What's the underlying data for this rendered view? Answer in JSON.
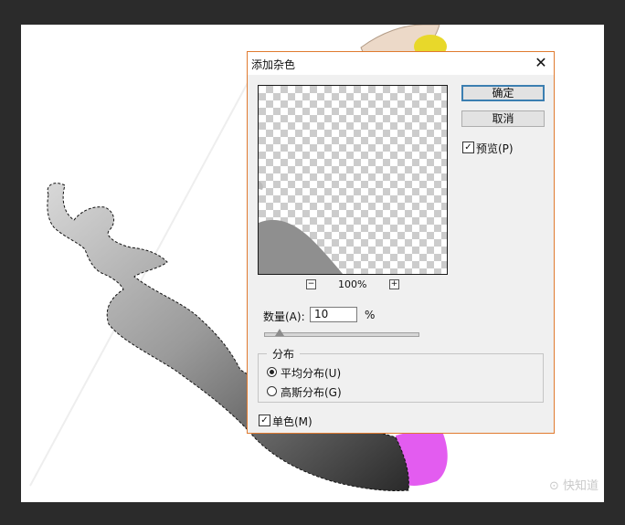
{
  "dialog": {
    "title": "添加杂色",
    "close_icon": "close-icon",
    "ok_label": "确定",
    "cancel_label": "取消",
    "preview_label": "预览(P)",
    "preview_checked": true,
    "zoom": {
      "minus_icon": "−",
      "plus_icon": "+",
      "level": "100%"
    },
    "amount": {
      "label": "数量(A):",
      "value": "10",
      "unit": "%",
      "slider_fraction": 0.1
    },
    "distribution": {
      "legend": "分布",
      "options": [
        {
          "label": "平均分布(U)",
          "selected": true
        },
        {
          "label": "高斯分布(G)",
          "selected": false
        }
      ]
    },
    "monochrome": {
      "label": "单色(M)",
      "checked": true
    }
  },
  "watermark": "⊙ 快知道",
  "colors": {
    "dialog_border": "#e07a2f",
    "primary_border": "#3c7fb1",
    "magenta_dress": "#e35cf0",
    "hair_yellow": "#e8d82a"
  }
}
